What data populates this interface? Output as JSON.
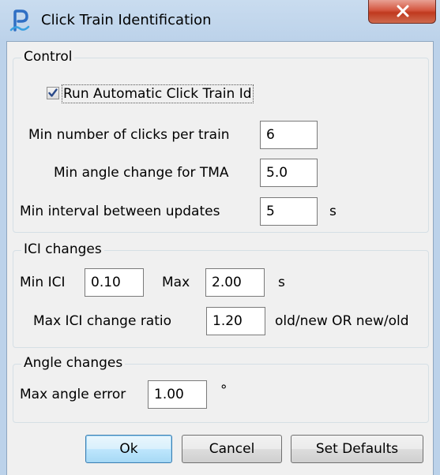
{
  "window": {
    "title": "Click Train Identification"
  },
  "control": {
    "legend": "Control",
    "run_auto": {
      "label": "Run Automatic Click Train Id",
      "checked": true
    },
    "min_clicks": {
      "label": "Min number of clicks per train",
      "value": "6"
    },
    "min_angle": {
      "label": "Min angle change for TMA",
      "value": "5.0"
    },
    "min_interval": {
      "label": "Min interval between updates",
      "value": "5",
      "unit": "s"
    }
  },
  "ici": {
    "legend": "ICI changes",
    "min": {
      "label": "Min ICI",
      "value": "0.10"
    },
    "max": {
      "label": "Max",
      "value": "2.00",
      "unit": "s"
    },
    "ratio": {
      "label": "Max ICI change ratio",
      "value": "1.20",
      "unit": "old/new OR new/old"
    }
  },
  "angle": {
    "legend": "Angle changes",
    "max_error": {
      "label": "Max angle error",
      "value": "1.00",
      "unit": "°"
    }
  },
  "buttons": {
    "ok": "Ok",
    "cancel": "Cancel",
    "defaults": "Set Defaults"
  },
  "colors": {
    "title_bar": "#bcd2ea",
    "close_button": "#c0391f",
    "checkmark": "#2a4a8a",
    "default_button_border": "#3c7fb1"
  }
}
